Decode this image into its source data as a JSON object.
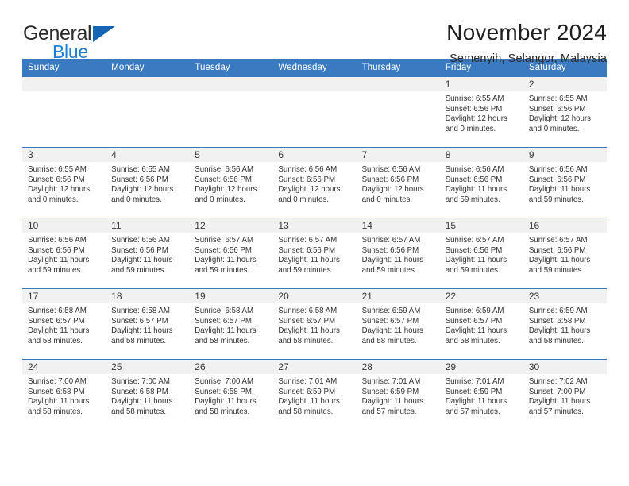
{
  "brand": {
    "name_top": "General",
    "name_bottom": "Blue",
    "accent_color": "#1f7fd4",
    "triangle_color": "#1565b6"
  },
  "header": {
    "title": "November 2024",
    "subtitle": "Semenyih, Selangor, Malaysia"
  },
  "calendar": {
    "header_bg": "#3a7ac0",
    "daynum_bg": "#f1f1f1",
    "weekdays": [
      "Sunday",
      "Monday",
      "Tuesday",
      "Wednesday",
      "Thursday",
      "Friday",
      "Saturday"
    ],
    "labels": {
      "sunrise": "Sunrise:",
      "sunset": "Sunset:",
      "daylight": "Daylight:"
    },
    "weeks": [
      [
        {
          "day": "",
          "blank": true
        },
        {
          "day": "",
          "blank": true
        },
        {
          "day": "",
          "blank": true
        },
        {
          "day": "",
          "blank": true
        },
        {
          "day": "",
          "blank": true
        },
        {
          "day": "1",
          "sunrise": "Sunrise: 6:55 AM",
          "sunset": "Sunset: 6:56 PM",
          "daylight": "Daylight: 12 hours and 0 minutes."
        },
        {
          "day": "2",
          "sunrise": "Sunrise: 6:55 AM",
          "sunset": "Sunset: 6:56 PM",
          "daylight": "Daylight: 12 hours and 0 minutes."
        }
      ],
      [
        {
          "day": "3",
          "sunrise": "Sunrise: 6:55 AM",
          "sunset": "Sunset: 6:56 PM",
          "daylight": "Daylight: 12 hours and 0 minutes."
        },
        {
          "day": "4",
          "sunrise": "Sunrise: 6:55 AM",
          "sunset": "Sunset: 6:56 PM",
          "daylight": "Daylight: 12 hours and 0 minutes."
        },
        {
          "day": "5",
          "sunrise": "Sunrise: 6:56 AM",
          "sunset": "Sunset: 6:56 PM",
          "daylight": "Daylight: 12 hours and 0 minutes."
        },
        {
          "day": "6",
          "sunrise": "Sunrise: 6:56 AM",
          "sunset": "Sunset: 6:56 PM",
          "daylight": "Daylight: 12 hours and 0 minutes."
        },
        {
          "day": "7",
          "sunrise": "Sunrise: 6:56 AM",
          "sunset": "Sunset: 6:56 PM",
          "daylight": "Daylight: 12 hours and 0 minutes."
        },
        {
          "day": "8",
          "sunrise": "Sunrise: 6:56 AM",
          "sunset": "Sunset: 6:56 PM",
          "daylight": "Daylight: 11 hours and 59 minutes."
        },
        {
          "day": "9",
          "sunrise": "Sunrise: 6:56 AM",
          "sunset": "Sunset: 6:56 PM",
          "daylight": "Daylight: 11 hours and 59 minutes."
        }
      ],
      [
        {
          "day": "10",
          "sunrise": "Sunrise: 6:56 AM",
          "sunset": "Sunset: 6:56 PM",
          "daylight": "Daylight: 11 hours and 59 minutes."
        },
        {
          "day": "11",
          "sunrise": "Sunrise: 6:56 AM",
          "sunset": "Sunset: 6:56 PM",
          "daylight": "Daylight: 11 hours and 59 minutes."
        },
        {
          "day": "12",
          "sunrise": "Sunrise: 6:57 AM",
          "sunset": "Sunset: 6:56 PM",
          "daylight": "Daylight: 11 hours and 59 minutes."
        },
        {
          "day": "13",
          "sunrise": "Sunrise: 6:57 AM",
          "sunset": "Sunset: 6:56 PM",
          "daylight": "Daylight: 11 hours and 59 minutes."
        },
        {
          "day": "14",
          "sunrise": "Sunrise: 6:57 AM",
          "sunset": "Sunset: 6:56 PM",
          "daylight": "Daylight: 11 hours and 59 minutes."
        },
        {
          "day": "15",
          "sunrise": "Sunrise: 6:57 AM",
          "sunset": "Sunset: 6:56 PM",
          "daylight": "Daylight: 11 hours and 59 minutes."
        },
        {
          "day": "16",
          "sunrise": "Sunrise: 6:57 AM",
          "sunset": "Sunset: 6:56 PM",
          "daylight": "Daylight: 11 hours and 59 minutes."
        }
      ],
      [
        {
          "day": "17",
          "sunrise": "Sunrise: 6:58 AM",
          "sunset": "Sunset: 6:57 PM",
          "daylight": "Daylight: 11 hours and 58 minutes."
        },
        {
          "day": "18",
          "sunrise": "Sunrise: 6:58 AM",
          "sunset": "Sunset: 6:57 PM",
          "daylight": "Daylight: 11 hours and 58 minutes."
        },
        {
          "day": "19",
          "sunrise": "Sunrise: 6:58 AM",
          "sunset": "Sunset: 6:57 PM",
          "daylight": "Daylight: 11 hours and 58 minutes."
        },
        {
          "day": "20",
          "sunrise": "Sunrise: 6:58 AM",
          "sunset": "Sunset: 6:57 PM",
          "daylight": "Daylight: 11 hours and 58 minutes."
        },
        {
          "day": "21",
          "sunrise": "Sunrise: 6:59 AM",
          "sunset": "Sunset: 6:57 PM",
          "daylight": "Daylight: 11 hours and 58 minutes."
        },
        {
          "day": "22",
          "sunrise": "Sunrise: 6:59 AM",
          "sunset": "Sunset: 6:57 PM",
          "daylight": "Daylight: 11 hours and 58 minutes."
        },
        {
          "day": "23",
          "sunrise": "Sunrise: 6:59 AM",
          "sunset": "Sunset: 6:58 PM",
          "daylight": "Daylight: 11 hours and 58 minutes."
        }
      ],
      [
        {
          "day": "24",
          "sunrise": "Sunrise: 7:00 AM",
          "sunset": "Sunset: 6:58 PM",
          "daylight": "Daylight: 11 hours and 58 minutes."
        },
        {
          "day": "25",
          "sunrise": "Sunrise: 7:00 AM",
          "sunset": "Sunset: 6:58 PM",
          "daylight": "Daylight: 11 hours and 58 minutes."
        },
        {
          "day": "26",
          "sunrise": "Sunrise: 7:00 AM",
          "sunset": "Sunset: 6:58 PM",
          "daylight": "Daylight: 11 hours and 58 minutes."
        },
        {
          "day": "27",
          "sunrise": "Sunrise: 7:01 AM",
          "sunset": "Sunset: 6:59 PM",
          "daylight": "Daylight: 11 hours and 58 minutes."
        },
        {
          "day": "28",
          "sunrise": "Sunrise: 7:01 AM",
          "sunset": "Sunset: 6:59 PM",
          "daylight": "Daylight: 11 hours and 57 minutes."
        },
        {
          "day": "29",
          "sunrise": "Sunrise: 7:01 AM",
          "sunset": "Sunset: 6:59 PM",
          "daylight": "Daylight: 11 hours and 57 minutes."
        },
        {
          "day": "30",
          "sunrise": "Sunrise: 7:02 AM",
          "sunset": "Sunset: 7:00 PM",
          "daylight": "Daylight: 11 hours and 57 minutes."
        }
      ]
    ]
  }
}
